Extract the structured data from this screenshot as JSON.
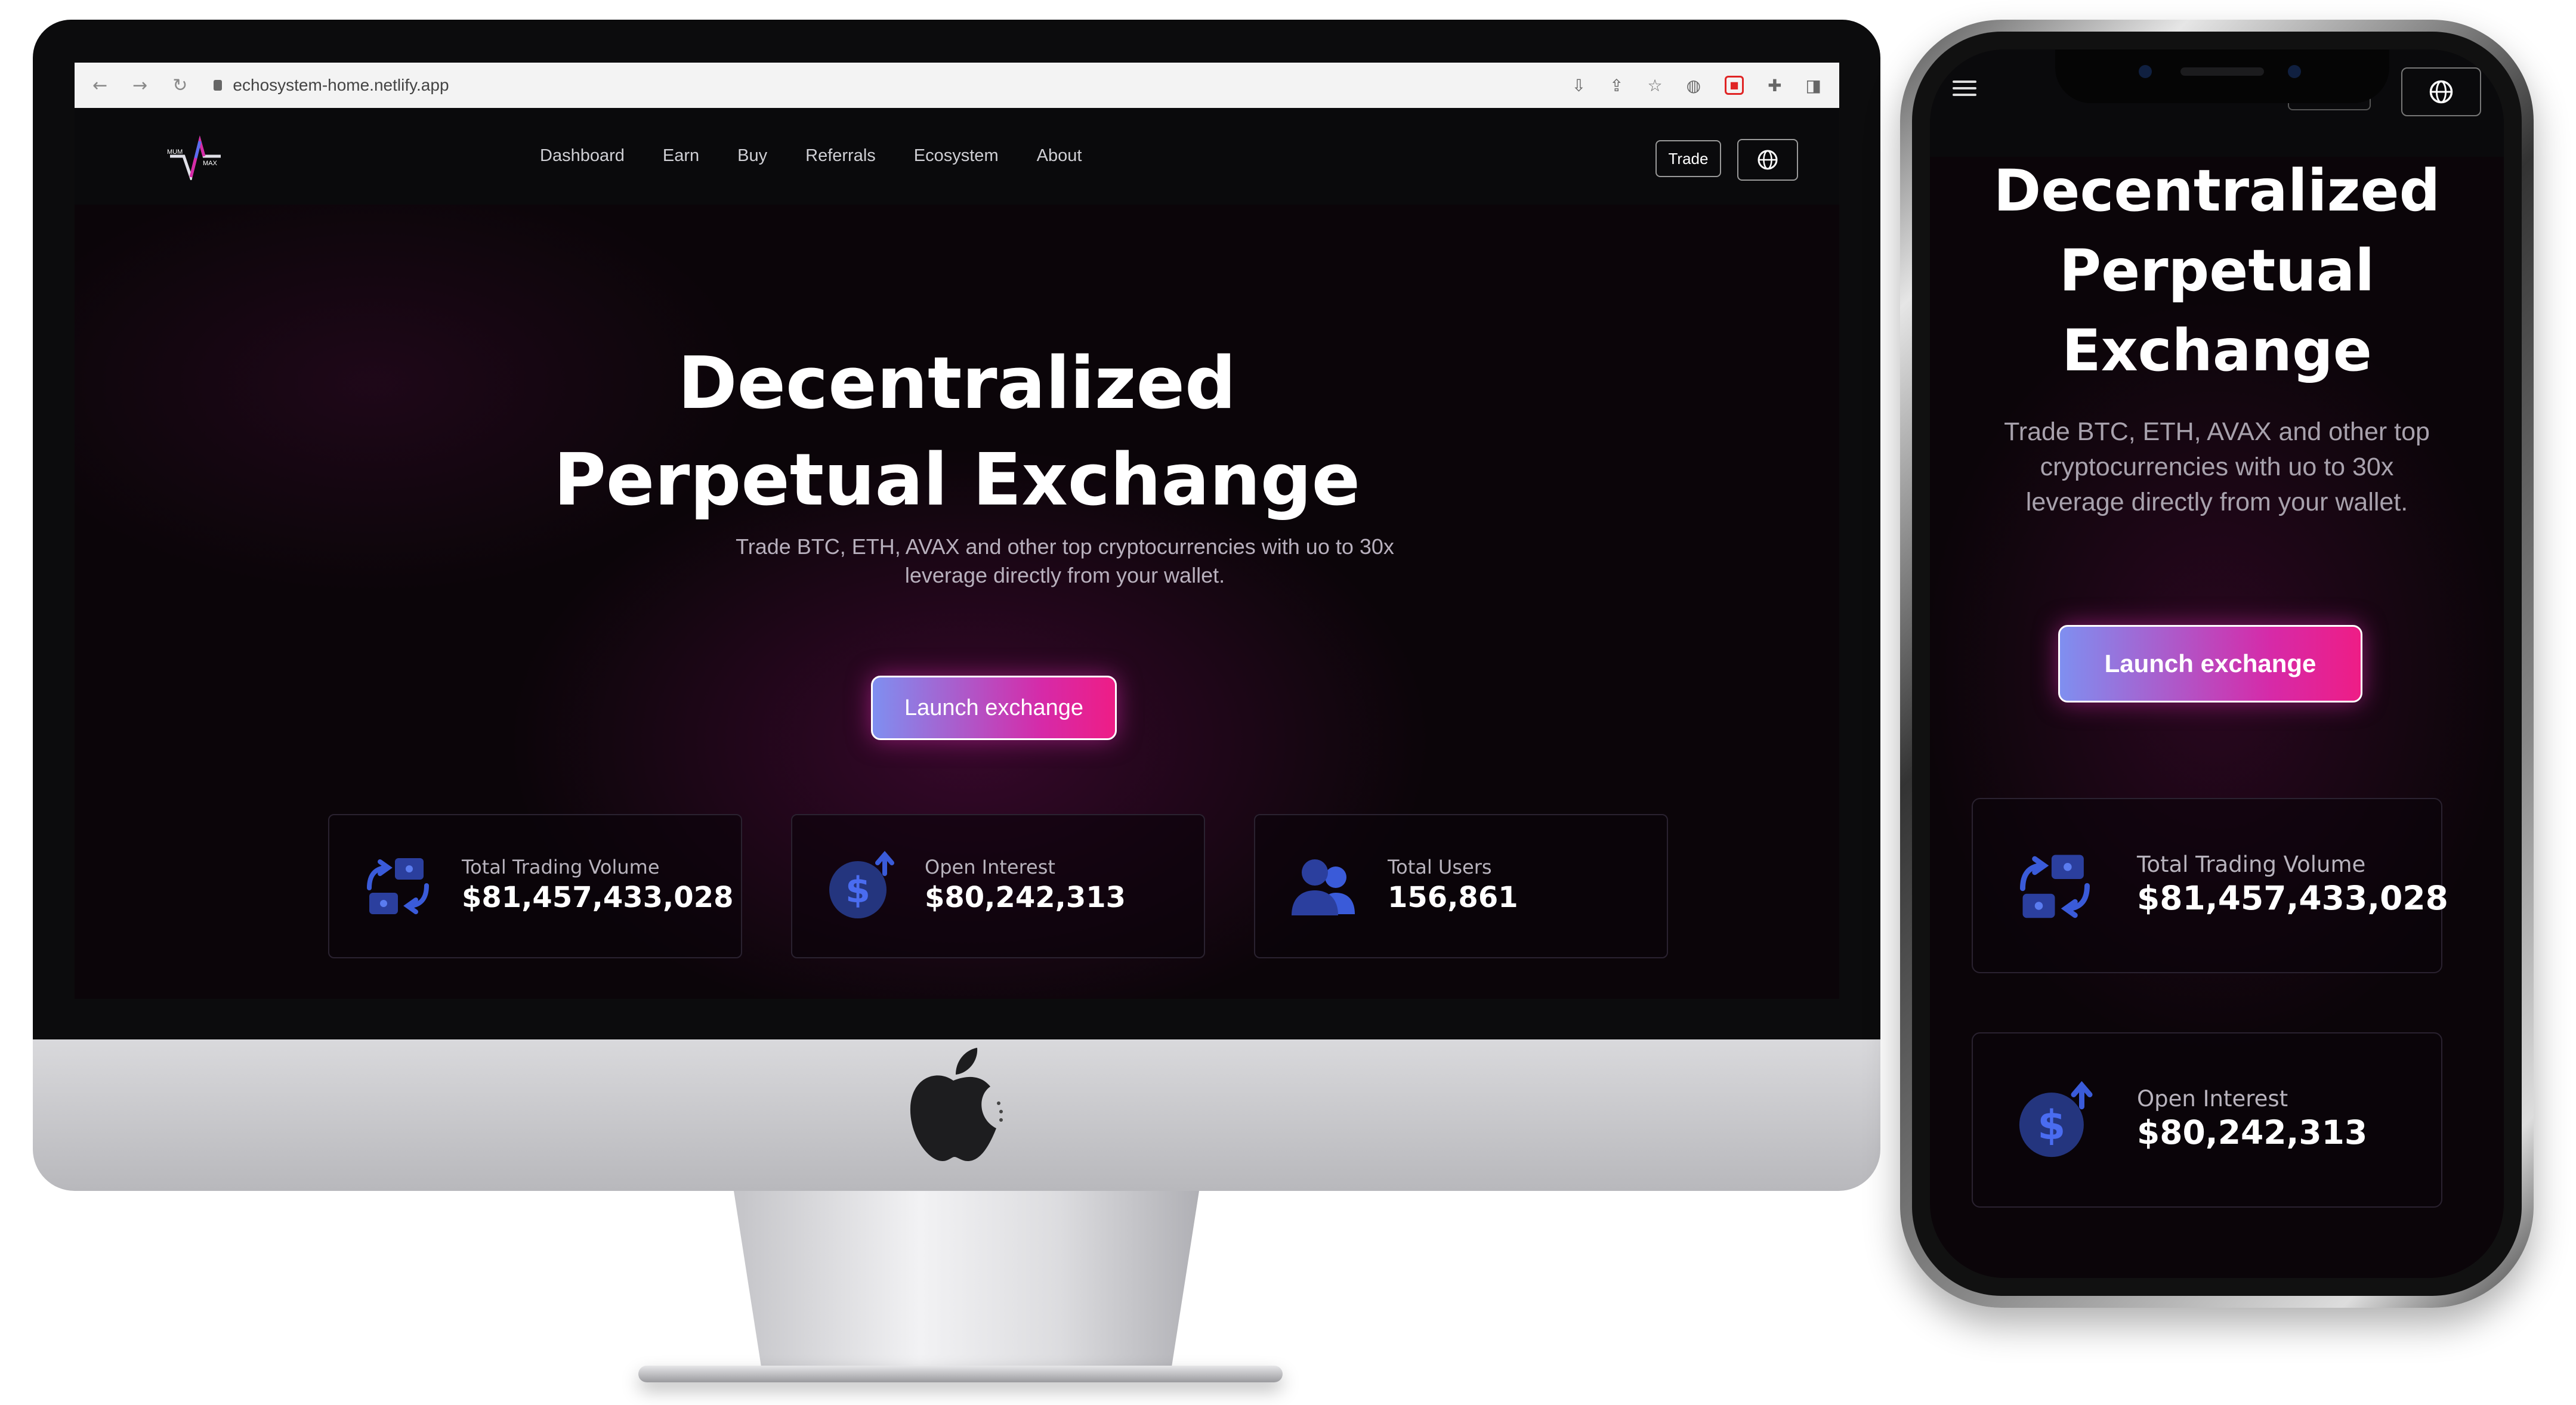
{
  "browser": {
    "url": "echosystem-home.netlify.app",
    "nav": {
      "back": "←",
      "forward": "→",
      "reload": "↻"
    }
  },
  "site": {
    "logo": {
      "top_text": "MUM",
      "bottom_text": "MAX"
    },
    "nav": [
      {
        "label": "Dashboard"
      },
      {
        "label": "Earn"
      },
      {
        "label": "Buy"
      },
      {
        "label": "Referrals"
      },
      {
        "label": "Ecosystem"
      },
      {
        "label": "About"
      }
    ],
    "trade_label": "Trade"
  },
  "hero": {
    "title_line1": "Decentralized",
    "title_line2": "Perpetual Exchange",
    "subtitle_line1": "Trade BTC, ETH, AVAX and other top cryptocurrencies with uo to 30x",
    "subtitle_line2": "leverage directly from your wallet.",
    "cta": "Launch exchange"
  },
  "stats": [
    {
      "label": "Total Trading Volume",
      "value": "$81,457,433,028",
      "icon": "trade-swap-icon"
    },
    {
      "label": "Open Interest",
      "value": "$80,242,313",
      "icon": "dollar-up-icon"
    },
    {
      "label": "Total Users",
      "value": "156,861",
      "icon": "users-icon"
    }
  ],
  "mobile": {
    "title_lines": [
      "Decentralized",
      "Perpetual",
      "Exchange"
    ],
    "subtitle_lines": [
      "Trade BTC, ETH, AVAX and other top",
      "cryptocurrencies with uo to 30x",
      "leverage directly from your wallet."
    ],
    "cta": "Launch exchange"
  },
  "colors": {
    "accent_start": "#7f8ff0",
    "accent_end": "#ee1d86",
    "icon_blue": "#3a5bd9",
    "background": "#0b0509"
  }
}
